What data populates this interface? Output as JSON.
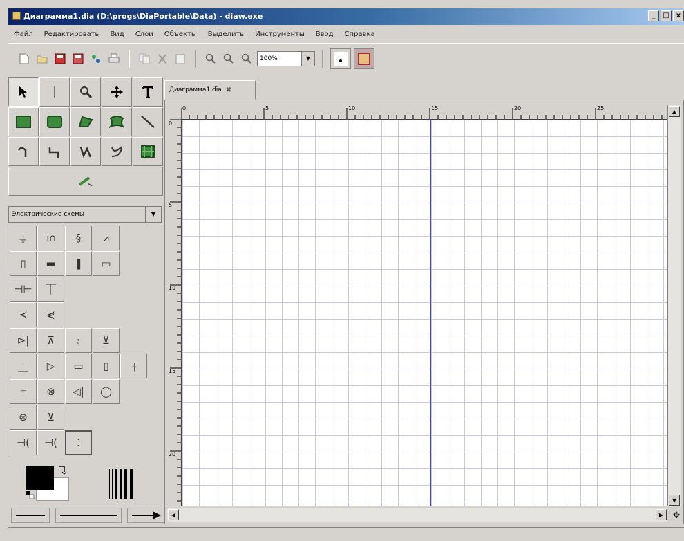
{
  "window": {
    "title": "Диаграмма1.dia (D:\\progs\\DiaPortable\\Data) - diaw.exe",
    "min_label": "_",
    "max_label": "□",
    "close_label": "x"
  },
  "menu": [
    "Файл",
    "Редактировать",
    "Вид",
    "Слои",
    "Объекты",
    "Выделить",
    "Инструменты",
    "Ввод",
    "Справка"
  ],
  "toolbar": {
    "zoom_value": "100%",
    "zoom_dropdown": "▼"
  },
  "toolbox": {
    "sheet_value": "Электрические схемы",
    "sheet_dropdown": "▼"
  },
  "document": {
    "tab_label": "Диаграмма1.dia",
    "tab_close": "✖"
  },
  "ruler": {
    "h_labels": [
      "0",
      "5",
      "10",
      "15",
      "20",
      "25"
    ],
    "v_labels": [
      "0",
      "5",
      "10",
      "15",
      "20"
    ]
  },
  "status": {
    "text": ""
  }
}
